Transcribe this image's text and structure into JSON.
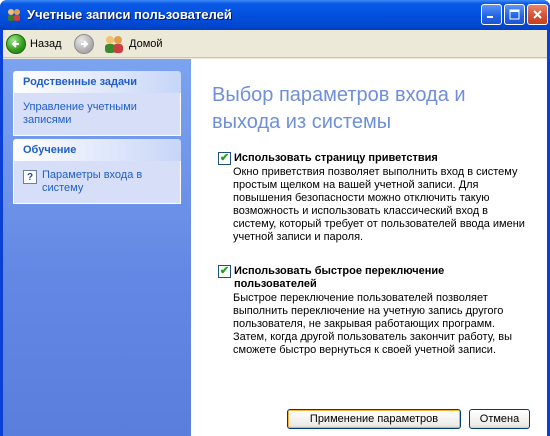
{
  "window": {
    "title": "Учетные записи пользователей",
    "title_icon": "users-icon",
    "controls": [
      "minimize",
      "maximize",
      "close"
    ]
  },
  "toolbar": {
    "back_label": "Назад",
    "forward_icon": "forward-arrow-icon",
    "home_label": "Домой"
  },
  "sidebar": {
    "related_tasks": {
      "heading": "Родственные задачи",
      "links": [
        "Управление учетными записями"
      ]
    },
    "learn": {
      "heading": "Обучение",
      "links": [
        "Параметры входа в систему"
      ]
    }
  },
  "main": {
    "title": "Выбор параметров входа и выхода из системы",
    "options": [
      {
        "label": "Использовать страницу приветствия",
        "checked": true,
        "description": "Окно приветствия позволяет выполнить вход в систему простым щелком на вашей учетной записи. Для повышения безопасности можно отключить такую возможность и использовать классический вход в систему, который требует от пользователей ввода имени учетной записи и пароля."
      },
      {
        "label": "Использовать быстрое переключение пользователей",
        "checked": true,
        "description": "Быстрое переключение пользователей позволяет выполнить переключение на учетную запись другого пользователя, не закрывая работающих программ. Затем, когда другой пользователь закончит работу, вы сможете быстро вернуться к своей учетной записи."
      }
    ],
    "apply_label": "Применение параметров",
    "cancel_label": "Отмена"
  },
  "colors": {
    "titlebar": "#0351e0",
    "sidebar": "#6287e4",
    "link": "#215dc6",
    "heading": "#6f8fd8"
  }
}
